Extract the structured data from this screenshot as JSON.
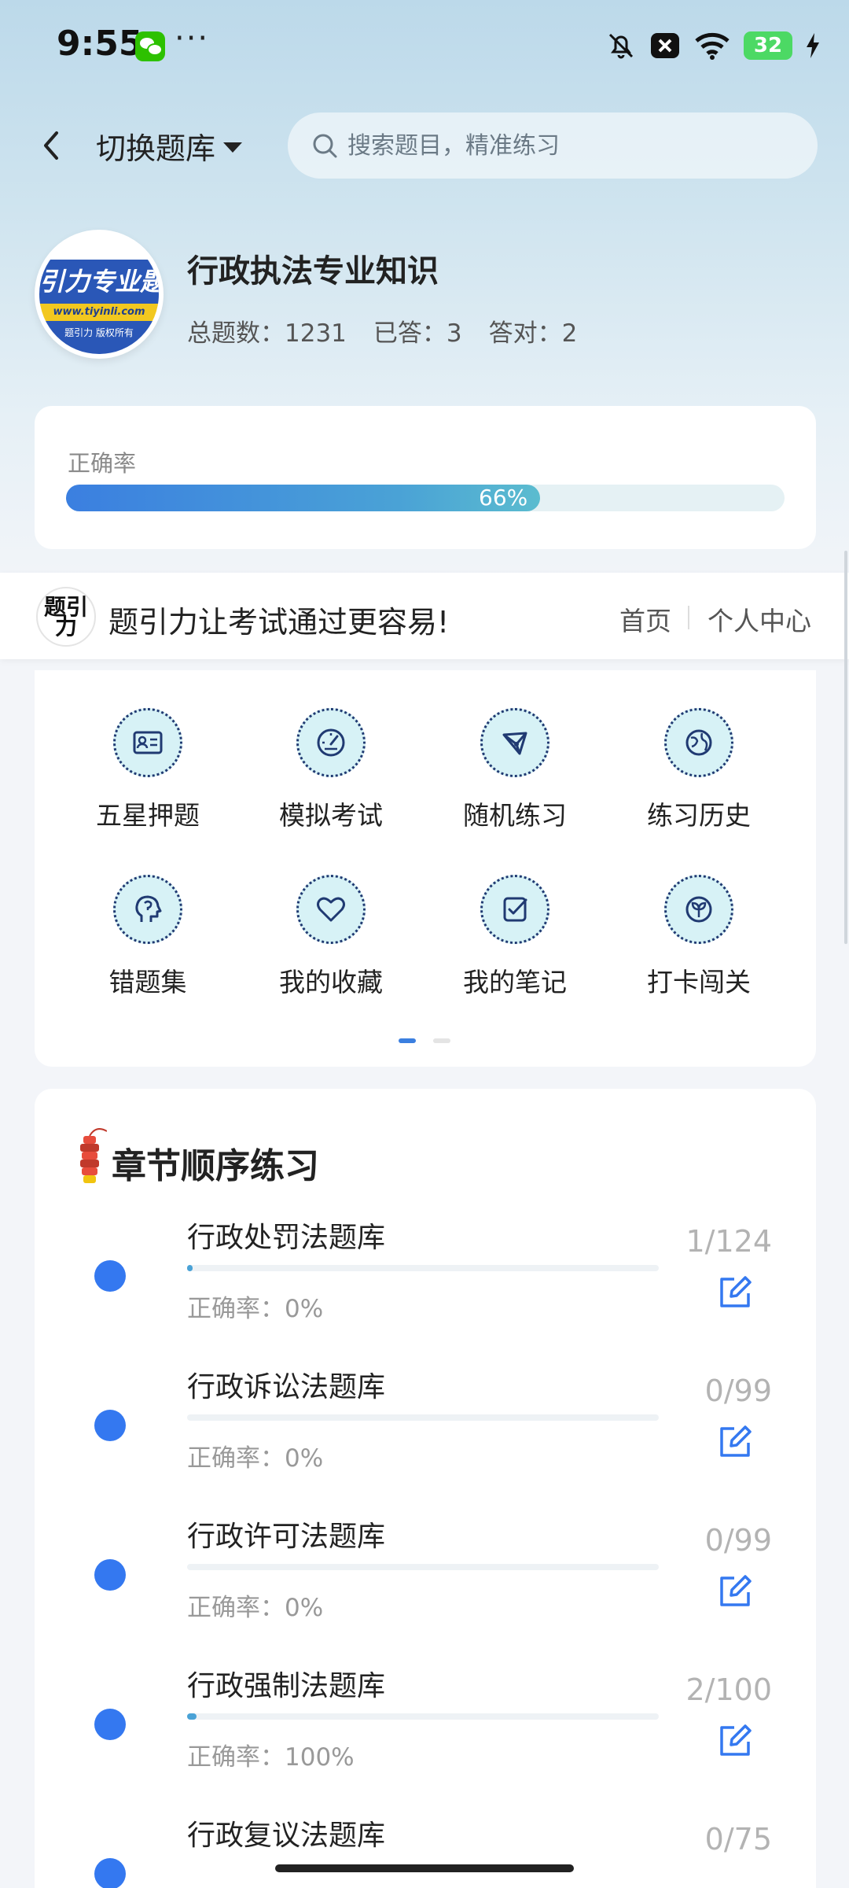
{
  "status_bar": {
    "time": "9:55",
    "more": "···",
    "battery": "32"
  },
  "nav": {
    "switch_bank": "切换题库",
    "search_placeholder": "搜索题目，精准练习"
  },
  "bank": {
    "logo_text": "引力专业题",
    "logo_url": "www.tiyinli.com",
    "logo_copyright": "题引力 版权所有",
    "title": "行政执法专业知识",
    "total": "总题数：1231",
    "answered": "已答：3",
    "correct": "答对：2"
  },
  "accuracy": {
    "label": "正确率",
    "percent_text": "66%",
    "value": 0.66
  },
  "promo": {
    "logo_text": "题引力",
    "slogan": "题引力让考试通过更容易!",
    "home": "首页",
    "personal_center": "个人中心"
  },
  "grid": {
    "items": [
      {
        "label": "五星押题",
        "icon": "id-card-icon"
      },
      {
        "label": "模拟考试",
        "icon": "gauge-icon"
      },
      {
        "label": "随机练习",
        "icon": "network-icon"
      },
      {
        "label": "练习历史",
        "icon": "globe-icon"
      },
      {
        "label": "错题集",
        "icon": "head-icon"
      },
      {
        "label": "我的收藏",
        "icon": "heart-icon"
      },
      {
        "label": "我的笔记",
        "icon": "note-check-icon"
      },
      {
        "label": "打卡闯关",
        "icon": "sprout-icon"
      }
    ],
    "page_count": 2,
    "active_page": 1
  },
  "chapters": {
    "title": "章节顺序练习",
    "items": [
      {
        "name": "行政处罚法题库",
        "accuracy": "正确率：0%",
        "count": "1/124",
        "progress": 0.008
      },
      {
        "name": "行政诉讼法题库",
        "accuracy": "正确率：0%",
        "count": "0/99",
        "progress": 0
      },
      {
        "name": "行政许可法题库",
        "accuracy": "正确率：0%",
        "count": "0/99",
        "progress": 0
      },
      {
        "name": "行政强制法题库",
        "accuracy": "正确率：100%",
        "count": "2/100",
        "progress": 0.02
      },
      {
        "name": "行政复议法题库",
        "accuracy": "",
        "count": "0/75",
        "progress": 0
      }
    ]
  },
  "colors": {
    "accent": "#3478f0",
    "icon_bg": "#d7f2f6",
    "icon_stroke": "#203a72"
  }
}
